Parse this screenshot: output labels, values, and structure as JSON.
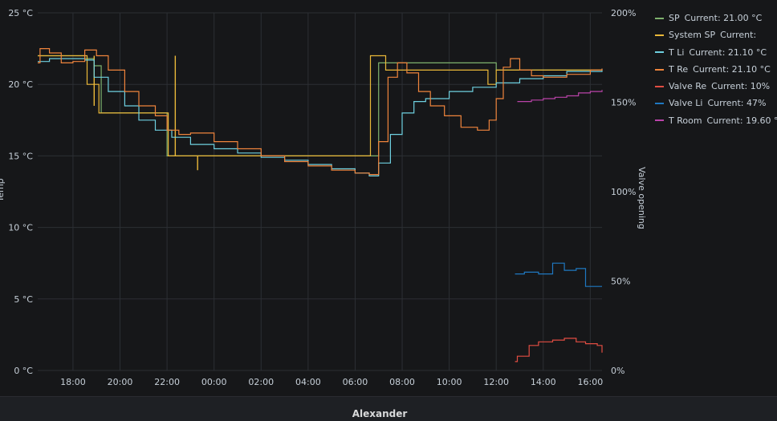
{
  "panel": {
    "footer_title": "Alexander"
  },
  "legend": [
    {
      "name": "SP",
      "current": "Current: 21.00 °C",
      "color": "#7eb26d"
    },
    {
      "name": "System SP",
      "current": "Current:",
      "color": "#eab839"
    },
    {
      "name": "T Li",
      "current": "Current: 21.10 °C",
      "color": "#6ed0e0"
    },
    {
      "name": "T Re",
      "current": "Current: 21.10 °C",
      "color": "#ef843c"
    },
    {
      "name": "Valve Re",
      "current": "Current: 10%",
      "color": "#e24d42"
    },
    {
      "name": "Valve Li",
      "current": "Current: 47%",
      "color": "#1f78c1"
    },
    {
      "name": "T Room",
      "current": "Current: 19.60 °C",
      "color": "#ba43a9"
    }
  ],
  "chart_data": {
    "type": "line",
    "xlabel": "",
    "ylabel": "Temp",
    "y2label": "Valve opening",
    "x_range": [
      16.5,
      16.5
    ],
    "x_ticks": [
      "18:00",
      "20:00",
      "22:00",
      "00:00",
      "02:00",
      "04:00",
      "06:00",
      "08:00",
      "10:00",
      "12:00",
      "14:00",
      "16:00"
    ],
    "y_ticks": [
      "0 °C",
      "5 °C",
      "10 °C",
      "15 °C",
      "20 °C",
      "25 °C"
    ],
    "ylim": [
      0,
      25
    ],
    "y2_ticks": [
      "0%",
      "50%",
      "100%",
      "150%",
      "200%"
    ],
    "y2lim": [
      0,
      200
    ],
    "grid": true,
    "legend_position": "right",
    "series": [
      {
        "name": "SP",
        "axis": "left",
        "step": true,
        "color": "#7eb26d",
        "points": [
          [
            16.5,
            22.0
          ],
          [
            18.5,
            21.8
          ],
          [
            18.9,
            21.3
          ],
          [
            19.2,
            18.0
          ],
          [
            21.5,
            18.0
          ],
          [
            22.0,
            15.0
          ],
          [
            30.5,
            15.0
          ],
          [
            31.0,
            21.5
          ],
          [
            36.0,
            21.0
          ],
          [
            40.5,
            21.0
          ]
        ]
      },
      {
        "name": "System SP",
        "axis": "left",
        "step": true,
        "color": "#eab839",
        "points": [
          [
            16.5,
            22.0
          ],
          [
            18.5,
            22.0
          ],
          [
            18.6,
            20.0
          ],
          [
            19.0,
            20.0
          ],
          [
            19.1,
            18.0
          ],
          [
            22.0,
            18.0
          ],
          [
            22.05,
            15.0
          ],
          [
            30.6,
            15.0
          ],
          [
            30.65,
            22.0
          ],
          [
            31.2,
            22.0
          ],
          [
            31.3,
            21.0
          ],
          [
            35.6,
            21.0
          ],
          [
            35.65,
            20.0
          ],
          [
            36.0,
            21.0
          ],
          [
            40.5,
            21.0
          ]
        ],
        "spikes": [
          [
            18.9,
            22.0,
            18.5
          ],
          [
            22.35,
            22.0,
            15.0
          ],
          [
            23.3,
            15.0,
            14.0
          ]
        ]
      },
      {
        "name": "T Li",
        "axis": "left",
        "step": true,
        "color": "#6ed0e0",
        "points": [
          [
            16.5,
            21.6
          ],
          [
            17.0,
            21.8
          ],
          [
            18.0,
            21.8
          ],
          [
            18.5,
            21.7
          ],
          [
            18.9,
            20.5
          ],
          [
            19.5,
            19.5
          ],
          [
            20.2,
            18.5
          ],
          [
            20.8,
            17.5
          ],
          [
            21.5,
            16.8
          ],
          [
            22.2,
            16.3
          ],
          [
            23.0,
            15.8
          ],
          [
            24.0,
            15.5
          ],
          [
            25.0,
            15.2
          ],
          [
            26.0,
            14.9
          ],
          [
            27.0,
            14.7
          ],
          [
            28.0,
            14.4
          ],
          [
            29.0,
            14.1
          ],
          [
            30.0,
            13.8
          ],
          [
            30.6,
            13.6
          ],
          [
            31.0,
            14.5
          ],
          [
            31.5,
            16.5
          ],
          [
            32.0,
            18.0
          ],
          [
            32.5,
            18.8
          ],
          [
            33.0,
            19.0
          ],
          [
            34.0,
            19.5
          ],
          [
            35.0,
            19.8
          ],
          [
            36.0,
            20.1
          ],
          [
            37.0,
            20.4
          ],
          [
            38.0,
            20.6
          ],
          [
            39.0,
            20.9
          ],
          [
            40.5,
            21.1
          ]
        ]
      },
      {
        "name": "T Re",
        "axis": "left",
        "step": true,
        "color": "#ef843c",
        "points": [
          [
            16.5,
            21.5
          ],
          [
            16.6,
            22.5
          ],
          [
            17.0,
            22.2
          ],
          [
            17.5,
            21.5
          ],
          [
            18.0,
            21.6
          ],
          [
            18.5,
            22.4
          ],
          [
            19.0,
            22.0
          ],
          [
            19.5,
            21.0
          ],
          [
            20.2,
            19.5
          ],
          [
            20.8,
            18.5
          ],
          [
            21.5,
            17.8
          ],
          [
            22.0,
            16.8
          ],
          [
            22.5,
            16.5
          ],
          [
            23.0,
            16.6
          ],
          [
            24.0,
            16.0
          ],
          [
            25.0,
            15.5
          ],
          [
            26.0,
            15.0
          ],
          [
            27.0,
            14.6
          ],
          [
            28.0,
            14.3
          ],
          [
            29.0,
            14.0
          ],
          [
            30.0,
            13.8
          ],
          [
            30.6,
            13.7
          ],
          [
            31.0,
            16.0
          ],
          [
            31.4,
            20.5
          ],
          [
            31.8,
            21.5
          ],
          [
            32.2,
            20.8
          ],
          [
            32.7,
            19.5
          ],
          [
            33.2,
            18.5
          ],
          [
            33.8,
            17.8
          ],
          [
            34.5,
            17.0
          ],
          [
            35.2,
            16.8
          ],
          [
            35.7,
            17.5
          ],
          [
            36.0,
            19.0
          ],
          [
            36.3,
            21.2
          ],
          [
            36.6,
            21.8
          ],
          [
            37.0,
            21.0
          ],
          [
            37.5,
            20.6
          ],
          [
            38.0,
            20.5
          ],
          [
            39.0,
            20.7
          ],
          [
            40.0,
            21.0
          ],
          [
            40.5,
            21.1
          ]
        ]
      },
      {
        "name": "Valve Re",
        "axis": "right",
        "step": true,
        "color": "#e24d42",
        "points": [
          [
            36.8,
            5
          ],
          [
            36.9,
            8
          ],
          [
            37.4,
            14
          ],
          [
            37.8,
            16
          ],
          [
            38.4,
            17
          ],
          [
            38.9,
            18
          ],
          [
            39.4,
            16
          ],
          [
            39.8,
            15
          ],
          [
            40.3,
            14
          ],
          [
            40.5,
            10
          ]
        ]
      },
      {
        "name": "Valve Li",
        "axis": "right",
        "step": true,
        "color": "#1f78c1",
        "points": [
          [
            36.8,
            54
          ],
          [
            37.2,
            55
          ],
          [
            37.8,
            54
          ],
          [
            38.4,
            60
          ],
          [
            38.9,
            56
          ],
          [
            39.4,
            57
          ],
          [
            39.8,
            47
          ],
          [
            40.5,
            47
          ]
        ]
      },
      {
        "name": "T Room",
        "axis": "left",
        "step": true,
        "color": "#ba43a9",
        "points": [
          [
            36.9,
            18.8
          ],
          [
            37.5,
            18.9
          ],
          [
            38.0,
            19.0
          ],
          [
            38.5,
            19.1
          ],
          [
            39.0,
            19.2
          ],
          [
            39.5,
            19.4
          ],
          [
            40.0,
            19.5
          ],
          [
            40.5,
            19.6
          ]
        ]
      }
    ]
  }
}
